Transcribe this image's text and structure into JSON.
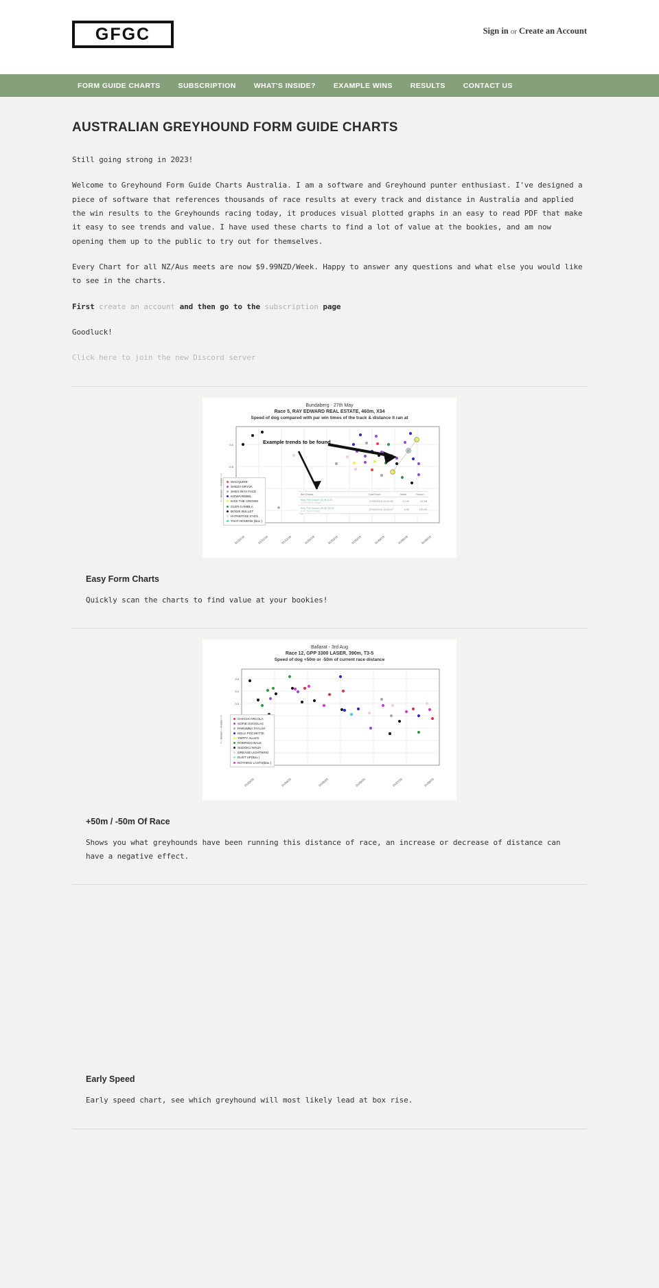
{
  "header": {
    "logo_text": "GFGC",
    "sign_in": "Sign in",
    "separator": "or",
    "create_account": "Create an Account"
  },
  "nav": {
    "items": [
      {
        "label": "FORM GUIDE CHARTS"
      },
      {
        "label": "SUBSCRIPTION"
      },
      {
        "label": "WHAT'S INSIDE?"
      },
      {
        "label": "EXAMPLE WINS"
      },
      {
        "label": "RESULTS"
      },
      {
        "label": "CONTACT US"
      }
    ]
  },
  "main": {
    "title": "AUSTRALIAN GREYHOUND FORM GUIDE CHARTS",
    "tagline": "Still going strong in 2023!",
    "intro": "Welcome to Greyhound Form Guide Charts Australia. I am a software and Greyhound punter enthusiast. I've designed a piece of software that references thousands of race results at every track and distance in Australia and applied the win results to the Greyhounds racing today, it produces visual plotted graphs in an easy to read PDF that make it easy to see trends and value. I have used these charts to find a lot of value at the bookies, and am now opening them up to the public to try out for themselves.",
    "pricing": "Every Chart for all NZ/Aus meets are now $9.99NZD/Week. Happy to answer any questions and what else you would like to see in the charts.",
    "cta_first": "First",
    "cta_create_account": "create an account",
    "cta_and_then": "and then go to the",
    "cta_subscription": "subscription",
    "cta_page": "page",
    "goodluck": "Goodluck!",
    "discord_link": "Click here to join the new Discord server"
  },
  "features": [
    {
      "title": "Easy Form Charts",
      "description": "Quickly scan the charts to find value at your bookies!"
    },
    {
      "title": "+50m / -50m Of Race",
      "description": "Shows you what greyhounds have been running this distance of race, an increase or decrease of distance can have a negative effect."
    },
    {
      "title": "Early Speed",
      "description": "Early speed chart, see which greyhound will most likely lead at box rise."
    }
  ],
  "colors": {
    "nav_bg": "#87a07c",
    "page_bg": "#f2f2f0",
    "header_bg": "#ffffff",
    "text": "#333333",
    "muted_link": "#b9b9b9"
  },
  "chart_data": [
    {
      "type": "scatter",
      "title": "Bundaberg  -  27th May",
      "subtitle": "Race 5, RAY EDWARD REAL ESTATE, 460m, X34",
      "subtitle2": "Speed of dog compared with par win times of the track & distance it ran at",
      "ylabel": "<---Slower----Faster--->",
      "annotation": "Example trends to be found",
      "ylim": [
        -1.75,
        0.55
      ],
      "yticks": [
        0.0,
        -0.5,
        -1.0,
        -1.5
      ],
      "xticks": [
        "01/10/18",
        "01/11/18",
        "01/12/18",
        "01/01/19",
        "01/02/19",
        "01/03/19",
        "01/04/19",
        "01/05/19",
        "01/06/19"
      ],
      "legend": [
        {
          "name": "MACQUIRE",
          "color": "#e8484d"
        },
        {
          "name": "SHEZA DRYVA",
          "color": "#9a4fd0"
        },
        {
          "name": "SHES INYA FACE",
          "color": "#a8a8a8"
        },
        {
          "name": "KIEWA REBEL",
          "color": "#2b2bcf"
        },
        {
          "name": "KISS THE GROOM",
          "color": "#f2ef45"
        },
        {
          "name": "GLEN CAMBLA",
          "color": "#2f9e44"
        },
        {
          "name": "BOGIE BULLET",
          "color": "#1a1a1a"
        },
        {
          "name": "HYPNOTISE EYES",
          "color": "#f6c9d8"
        },
        {
          "name": "THAT HOUDINI (Box )",
          "color": "#37d8e8"
        }
      ],
      "bet_table": {
        "columns": [
          "Bet Details",
          "Date/Time",
          "Stake",
          "Return"
        ],
        "rows": [
          {
            "detail": "Kiss The Groom (5) @ 4.33",
            "sub": "13.99 NZD  Single",
            "datetime": "27/05/2019 10:22:30",
            "stake": "13.99",
            "return": "60.58"
          },
          {
            "detail": "Kiss The Groom (5) @ 26.00",
            "sub": "5.00 NZD  Single",
            "datetime": "27/05/2019 10:23:07",
            "stake": "5.00",
            "return": "130.00"
          }
        ]
      }
    },
    {
      "type": "scatter",
      "title": "Ballarat  -  3rd Aug",
      "subtitle": "Race 12, GPP 3300 LASER, 390m, T3-5",
      "subtitle2": "Speed of dog +50m or -50m of current race distance",
      "ylabel": "<---Slower----Faster--->",
      "ylim": [
        -1.05,
        0.5
      ],
      "yticks": [
        0.4,
        0.2,
        0.0,
        -0.2,
        -0.4,
        -0.6,
        -0.8,
        -1.0
      ],
      "xticks": [
        "01/03/20",
        "01/04/20",
        "01/05/20",
        "01/06/20",
        "01/07/20",
        "01/08/20"
      ],
      "legend": [
        {
          "name": "CHACHI ARCOLA",
          "color": "#d8393f"
        },
        {
          "name": "SOFIE GOGOLAC",
          "color": "#9a4fd0"
        },
        {
          "name": "PARUMBA TAYLAH",
          "color": "#a8a8a8"
        },
        {
          "name": "KELLI POCHETTE",
          "color": "#2b2bcf"
        },
        {
          "name": "YEPPY ALLEN",
          "color": "#f2ef45"
        },
        {
          "name": "RODRIGO BALE",
          "color": "#2f9e44"
        },
        {
          "name": "SUDOKU NINJA",
          "color": "#1a1a1a"
        },
        {
          "name": "GREASE LIGHTNING",
          "color": "#f6c9d8"
        },
        {
          "name": "DUST UP(Box )",
          "color": "#8fe8e0"
        },
        {
          "name": "NOTHING LASTS(Box )",
          "color": "#d63bd6"
        }
      ]
    }
  ]
}
